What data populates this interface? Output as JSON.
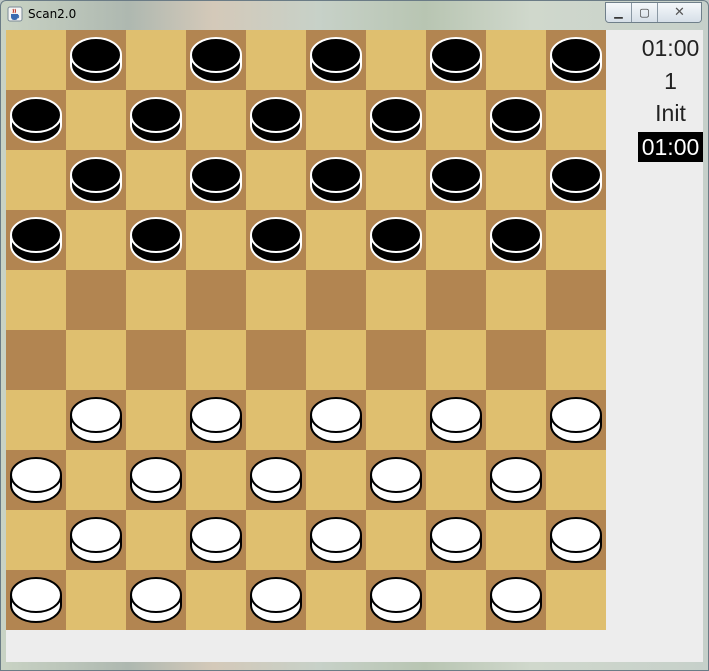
{
  "window": {
    "title": "Scan2.0",
    "minimize_glyph": "▁",
    "maximize_glyph": "▢",
    "close_glyph": "✕"
  },
  "colors": {
    "light_square": "#dfbf6f",
    "dark_square": "#b28551",
    "black_piece": "#000000",
    "white_piece": "#ffffff"
  },
  "icons": {
    "app": "java-cup-icon"
  },
  "board": {
    "size": 10,
    "rows": [
      [
        null,
        "b",
        null,
        "b",
        null,
        "b",
        null,
        "b",
        null,
        "b"
      ],
      [
        "b",
        null,
        "b",
        null,
        "b",
        null,
        "b",
        null,
        "b",
        null
      ],
      [
        null,
        "b",
        null,
        "b",
        null,
        "b",
        null,
        "b",
        null,
        "b"
      ],
      [
        "b",
        null,
        "b",
        null,
        "b",
        null,
        "b",
        null,
        "b",
        null
      ],
      [
        null,
        null,
        null,
        null,
        null,
        null,
        null,
        null,
        null,
        null
      ],
      [
        null,
        null,
        null,
        null,
        null,
        null,
        null,
        null,
        null,
        null
      ],
      [
        null,
        "w",
        null,
        "w",
        null,
        "w",
        null,
        "w",
        null,
        "w"
      ],
      [
        "w",
        null,
        "w",
        null,
        "w",
        null,
        "w",
        null,
        "w",
        null
      ],
      [
        null,
        "w",
        null,
        "w",
        null,
        "w",
        null,
        "w",
        null,
        "w"
      ],
      [
        "w",
        null,
        "w",
        null,
        "w",
        null,
        "w",
        null,
        "w",
        null
      ]
    ]
  },
  "sidebar": {
    "top_clock": "01:00",
    "move_number": "1",
    "status": "Init",
    "bottom_clock": "01:00"
  }
}
